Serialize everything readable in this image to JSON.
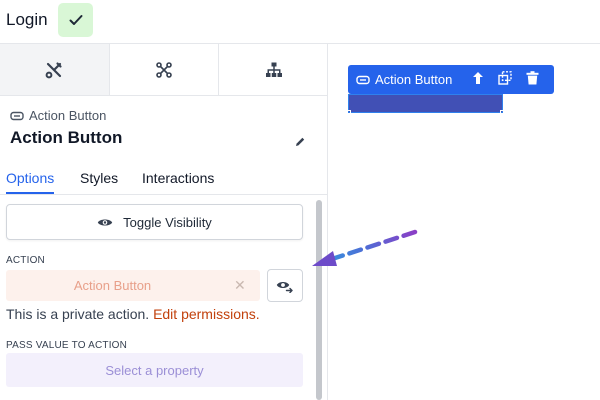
{
  "header": {
    "title": "Login"
  },
  "panel": {
    "component_type": "Action Button",
    "component_name": "Action Button",
    "sub_tabs": [
      {
        "label": "Options"
      },
      {
        "label": "Styles"
      },
      {
        "label": "Interactions"
      }
    ],
    "toggle_visibility_label": "Toggle Visibility",
    "action_label": "ACTION",
    "action_value": "Action Button",
    "private_note": "This is a private action.",
    "edit_permissions_link": "Edit permissions.",
    "pass_value_label": "PASS VALUE TO ACTION",
    "property_placeholder": "Select a property"
  },
  "canvas": {
    "button_label": "Action Button"
  },
  "colors": {
    "accent": "#2563eb",
    "success_bg": "#d9f7d6",
    "annotation_arrow": "#7c3aed"
  }
}
